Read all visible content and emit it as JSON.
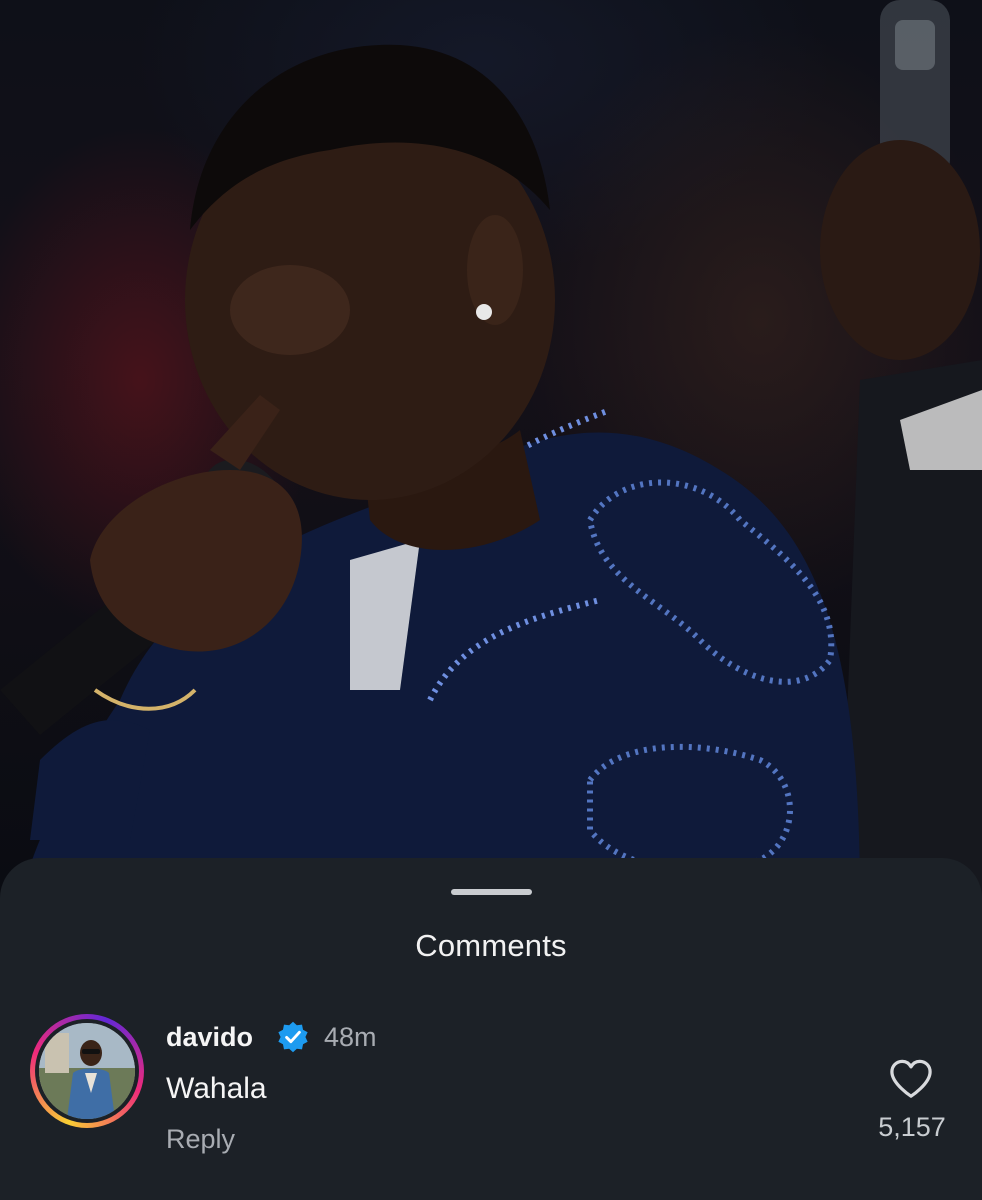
{
  "post": {
    "photo_icon": "performer-singing-photo"
  },
  "comments_sheet": {
    "title": "Comments",
    "comment": {
      "username": "davido",
      "verified_icon": "verified-badge-icon",
      "time": "48m",
      "text": "Wahala",
      "reply_label": "Reply",
      "like_icon": "heart-icon",
      "like_count": "5,157"
    }
  },
  "colors": {
    "sheet_bg": "#1c2127",
    "verified_blue": "#1d9bf0",
    "muted_text": "#a8acb2"
  }
}
